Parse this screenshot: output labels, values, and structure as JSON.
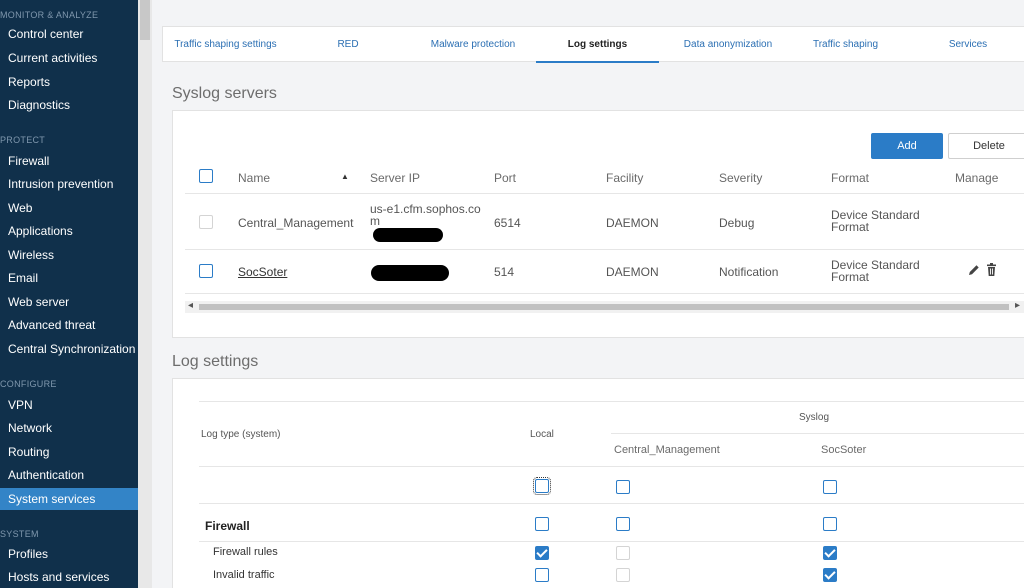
{
  "sidebar": {
    "sections": [
      "MONITOR & ANALYZE",
      "PROTECT",
      "CONFIGURE",
      "SYSTEM"
    ],
    "monitor_items": [
      "Control center",
      "Current activities",
      "Reports",
      "Diagnostics"
    ],
    "protect_items": [
      "Firewall",
      "Intrusion prevention",
      "Web",
      "Applications",
      "Wireless",
      "Email",
      "Web server",
      "Advanced threat",
      "Central Synchronization"
    ],
    "configure_items": [
      "VPN",
      "Network",
      "Routing",
      "Authentication",
      "System services"
    ],
    "system_items": [
      "Profiles",
      "Hosts and services"
    ],
    "active_item": "System services"
  },
  "tabs": [
    "Traffic shaping settings",
    "RED",
    "Malware protection",
    "Log settings",
    "Data anonymization",
    "Traffic shaping",
    "Services"
  ],
  "active_tab": "Log settings",
  "syslog": {
    "title": "Syslog servers",
    "add_label": "Add",
    "delete_label": "Delete",
    "columns": [
      "Name",
      "Server IP",
      "Port",
      "Facility",
      "Severity",
      "Format",
      "Manage"
    ],
    "sort_indicator": "▲",
    "rows": [
      {
        "name": "Central_Management",
        "server_ip": "us-e1.cfm.sophos.com",
        "port": "6514",
        "facility": "DAEMON",
        "severity": "Debug",
        "format": "Device Standard Format"
      },
      {
        "name": "SocSoter",
        "server_ip": "",
        "port": "514",
        "facility": "DAEMON",
        "severity": "Notification",
        "format": "Device Standard Format"
      }
    ]
  },
  "log_settings": {
    "title": "Log settings",
    "col_log_type": "Log type (system)",
    "col_local": "Local",
    "col_syslog": "Syslog",
    "syslog_servers": [
      "Central_Management",
      "SocSoter"
    ],
    "group": "Firewall",
    "rows": [
      {
        "label": "Firewall rules",
        "local": true,
        "central": false,
        "soc": true
      },
      {
        "label": "Invalid traffic",
        "local": false,
        "central": false,
        "soc": true
      }
    ]
  }
}
